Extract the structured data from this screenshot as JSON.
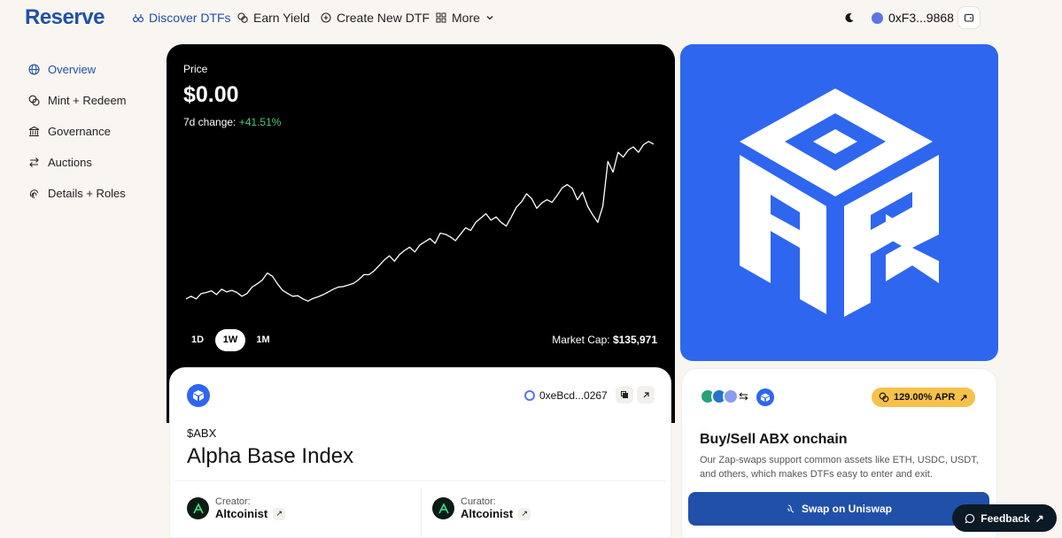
{
  "app": {
    "logo": "Reserve"
  },
  "nav": {
    "items": [
      {
        "label": "Discover DTFs",
        "icon": "binoculars-icon"
      },
      {
        "label": "Earn Yield",
        "icon": "coins-icon"
      },
      {
        "label": "Create New DTF",
        "icon": "plus-circle-icon"
      },
      {
        "label": "More",
        "icon": "grid-icon"
      }
    ],
    "wallet": "0xF3...9868"
  },
  "sidebar": {
    "items": [
      {
        "label": "Overview",
        "icon": "globe-icon"
      },
      {
        "label": "Mint + Redeem",
        "icon": "coins-icon"
      },
      {
        "label": "Governance",
        "icon": "bank-icon"
      },
      {
        "label": "Auctions",
        "icon": "swap-icon"
      },
      {
        "label": "Details + Roles",
        "icon": "fingerprint-icon"
      }
    ]
  },
  "chart_card": {
    "price_label": "Price",
    "price_value": "$0.00",
    "change_label": "7d change:",
    "change_value": "+41.51%",
    "ranges": [
      "1D",
      "1W",
      "1M"
    ],
    "active_range": "1W",
    "market_cap_label": "Market Cap:",
    "market_cap_value": "$135,971"
  },
  "chart_data": {
    "type": "line",
    "title": "",
    "xlabel": "",
    "ylabel": "",
    "values": [
      0.7,
      0.705,
      0.7,
      0.71,
      0.712,
      0.715,
      0.708,
      0.718,
      0.713,
      0.716,
      0.712,
      0.705,
      0.71,
      0.722,
      0.728,
      0.735,
      0.748,
      0.742,
      0.728,
      0.716,
      0.71,
      0.705,
      0.706,
      0.7,
      0.696,
      0.701,
      0.704,
      0.708,
      0.713,
      0.718,
      0.722,
      0.723,
      0.726,
      0.729,
      0.736,
      0.745,
      0.745,
      0.752,
      0.762,
      0.772,
      0.78,
      0.77,
      0.782,
      0.79,
      0.796,
      0.787,
      0.8,
      0.806,
      0.812,
      0.803,
      0.822,
      0.82,
      0.815,
      0.808,
      0.82,
      0.832,
      0.827,
      0.842,
      0.85,
      0.858,
      0.846,
      0.852,
      0.842,
      0.835,
      0.852,
      0.87,
      0.88,
      0.895,
      0.886,
      0.868,
      0.878,
      0.884,
      0.879,
      0.892,
      0.906,
      0.912,
      0.905,
      0.884,
      0.898,
      0.872,
      0.856,
      0.842,
      0.872,
      0.955,
      0.935,
      0.972,
      0.963,
      0.976,
      0.982,
      0.972,
      0.986,
      0.992,
      0.987
    ],
    "ylim": [
      0.68,
      1.0
    ]
  },
  "token": {
    "address": "0xeBcd...0267",
    "ticker": "$ABX",
    "name": "Alpha Base Index",
    "creator_label": "Creator:",
    "creator_name": "Altcoinist",
    "curator_label": "Curator:",
    "curator_name": "Altcoinist"
  },
  "swap_card": {
    "apr": "129.00% APR",
    "title": "Buy/Sell ABX onchain",
    "description": "Our Zap-swaps support common assets like ETH, USDC, USDT, and others, which makes DTFs easy to enter and exit.",
    "button": "Swap on Uniswap"
  },
  "feedback": "Feedback",
  "colors": {
    "brand": "#2150a9",
    "logo_bg": "#2f66f0",
    "positive": "#4ec77c",
    "apr": "#f5c14b"
  }
}
